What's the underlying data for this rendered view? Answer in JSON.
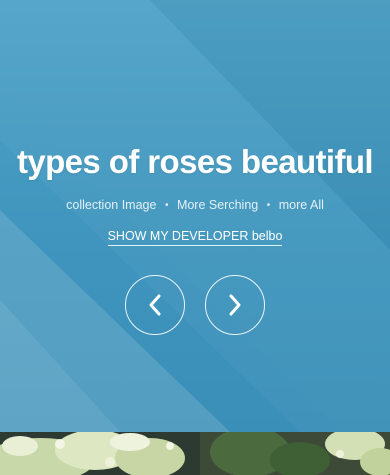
{
  "hero": {
    "title": "types of roses beautiful",
    "meta_items": [
      "collection Image",
      "More Serching",
      "more All"
    ],
    "meta_separator": "•",
    "developer_link": "SHOW MY DEVELOPER belbo",
    "prev_icon": "chevron-left-icon",
    "next_icon": "chevron-right-icon"
  },
  "colors": {
    "background": "#3f97bf",
    "text": "#ffffff"
  }
}
